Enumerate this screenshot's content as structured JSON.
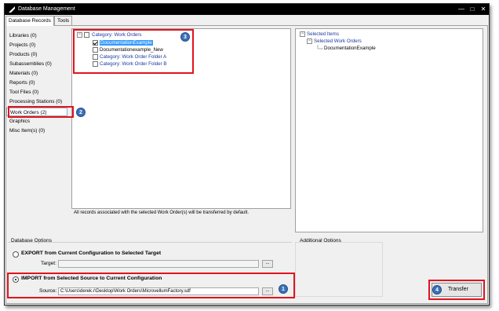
{
  "window": {
    "title": "Database Management"
  },
  "tabs": [
    "Database Records",
    "Tools"
  ],
  "categories": [
    "Libraries (0)",
    "Projects (0)",
    "Products (0)",
    "Subassemblies (0)",
    "Materials (0)",
    "Reports (0)",
    "Tool Files (0)",
    "Processing Stations (0)",
    "Work Orders (2)",
    "Graphics",
    "Misc Item(s) (0)"
  ],
  "records_tree": {
    "root": "Category: Work Orders",
    "items": [
      "DocumentationExample",
      "Documentationexample_New",
      "Category: Work Order Folder A",
      "Category: Work Order Folder B"
    ]
  },
  "records_note": "All records associated with the selected Work Order(s) will be transferred by default.",
  "selected_tree": {
    "root": "Selected Items",
    "child": "Selected Work Orders",
    "leaf": "DocumentationExample"
  },
  "db_options": {
    "group_label": "Database Options",
    "export_label": "EXPORT from Current Configuration to Selected Target",
    "target_label": "Target:",
    "target_value": "",
    "import_label": "IMPORT from Selected Source to Current Configuration",
    "source_label": "Source:",
    "source_value": "C:\\Users\\derek.r\\Desktop\\Work Orders\\MicrovellumFactory.sdf",
    "browse_label": "..."
  },
  "additional_options_label": "Additional Options",
  "transfer_label": "Transfer",
  "badges": [
    "1",
    "2",
    "3",
    "4"
  ],
  "colors": {
    "callout": "#e0141e",
    "badge": "#3b6fb6",
    "highlight": "#3399ff",
    "category_text": "#1a3a9e"
  }
}
